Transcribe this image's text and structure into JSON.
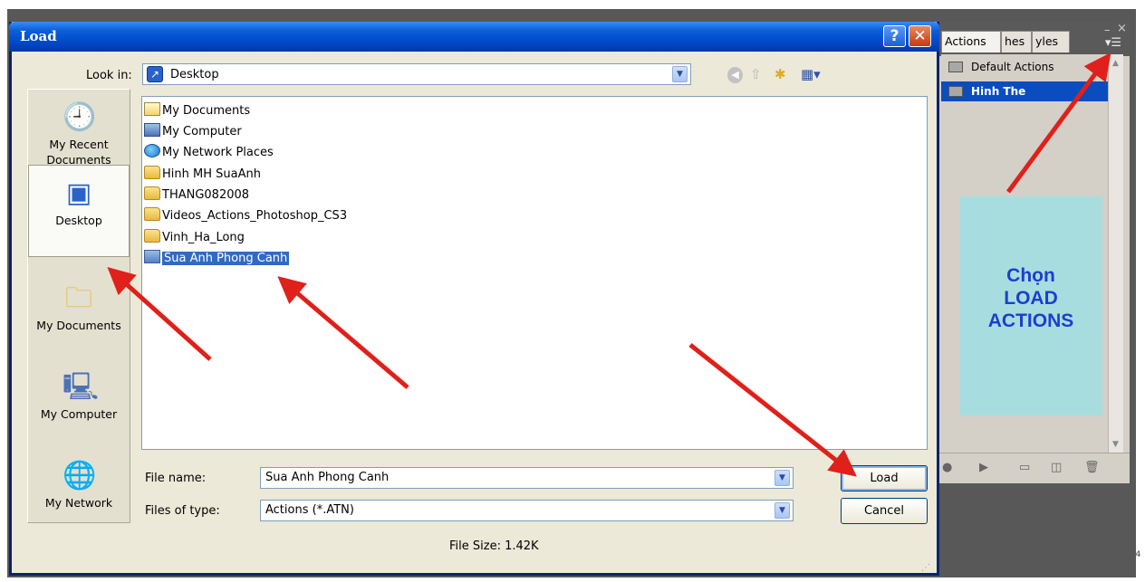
{
  "dialog": {
    "title": "Load",
    "help_glyph": "?",
    "close_glyph": "✕",
    "look_in_label": "Look in:",
    "look_in_value": "Desktop",
    "nav_icons": [
      "back-icon",
      "up-folder-icon",
      "new-folder-icon",
      "view-menu-icon"
    ],
    "places": [
      {
        "label": "My Recent\nDocuments",
        "icon": "recent-documents-icon",
        "selected": false
      },
      {
        "label": "Desktop",
        "icon": "desktop-icon",
        "selected": true
      },
      {
        "label": "My Documents",
        "icon": "my-documents-icon",
        "selected": false
      },
      {
        "label": "My Computer",
        "icon": "my-computer-icon",
        "selected": false
      },
      {
        "label": "My Network",
        "icon": "my-network-icon",
        "selected": false
      }
    ],
    "files": [
      {
        "name": "My Documents",
        "icon": "doc-folder-icon",
        "selected": false
      },
      {
        "name": "My Computer",
        "icon": "computer-icon",
        "selected": false
      },
      {
        "name": "My Network Places",
        "icon": "network-icon",
        "selected": false
      },
      {
        "name": "Hinh MH SuaAnh",
        "icon": "folder-icon",
        "selected": false
      },
      {
        "name": "THANG082008",
        "icon": "folder-icon",
        "selected": false
      },
      {
        "name": "Videos_Actions_Photoshop_CS3",
        "icon": "folder-icon",
        "selected": false
      },
      {
        "name": "Vinh_Ha_Long",
        "icon": "folder-icon",
        "selected": false
      },
      {
        "name": "Sua Anh Phong Canh",
        "icon": "atn-file-icon",
        "selected": true
      }
    ],
    "file_name_label": "File name:",
    "file_name_value": "Sua Anh Phong Canh",
    "files_of_type_label": "Files of type:",
    "files_of_type_value": "Actions (*.ATN)",
    "load_button": "Load",
    "cancel_button": "Cancel",
    "file_size": "File Size: 1.42K"
  },
  "actions_panel": {
    "tabs": [
      "Actions ×",
      "hes",
      "yles"
    ],
    "active_tab": "Actions ×",
    "items": [
      {
        "label": "Default Actions",
        "selected": false
      },
      {
        "label": "Hinh The",
        "selected": true
      }
    ],
    "bottom_icons": [
      "stop-icon",
      "play-icon",
      "new-set-icon",
      "new-action-icon",
      "delete-icon"
    ]
  },
  "annotation": {
    "lines": [
      "Chọn",
      "LOAD",
      "ACTIONS"
    ],
    "text_color": "#1b3fcf",
    "box_color": "#a8dde0",
    "arrow_color": "#e0201a"
  }
}
